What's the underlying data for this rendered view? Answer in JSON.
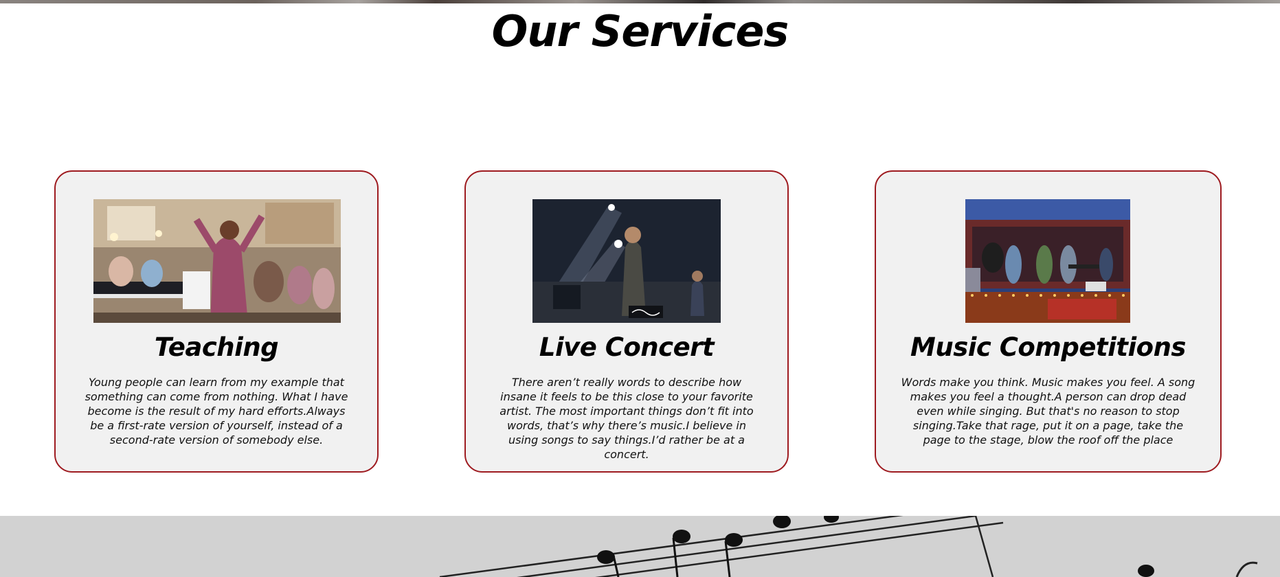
{
  "section": {
    "title": "Our Services"
  },
  "cards": [
    {
      "title": "Teaching",
      "text": "Young people can learn from my example that something can come from nothing. What I have become is the result of my hard efforts.Always be a first-rate version of yourself, instead of a second-rate version of somebody else."
    },
    {
      "title": "Live Concert",
      "text": "There aren’t really words to describe how insane it feels to be this close to your favorite artist. The most important things don’t fit into words, that’s why there’s music.I believe in using songs to say things.I’d rather be at a concert."
    },
    {
      "title": "Music Competitions",
      "text": "Words make you think. Music makes you feel. A song makes you feel a thought.A person can drop dead even while singing. But that's no reason to stop singing.Take that rage, put it on a page, take the page to the stage, blow the roof off the place"
    }
  ],
  "colors": {
    "card_border": "#9e1b20",
    "card_background": "#f1f1f1",
    "title_text": "#000000"
  }
}
